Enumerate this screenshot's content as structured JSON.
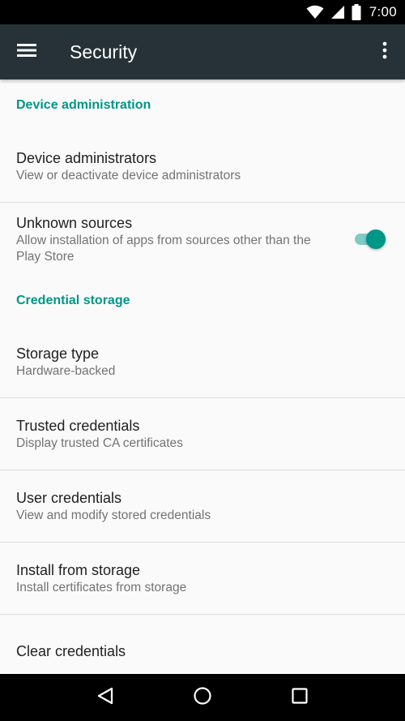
{
  "status_bar": {
    "time": "7:00",
    "icons": [
      "wifi-icon",
      "cellular-signal-icon",
      "battery-icon"
    ]
  },
  "app_bar": {
    "title": "Security",
    "left_icon": "menu-icon",
    "right_icon": "more-vert-icon",
    "background": "#263238"
  },
  "sections": {
    "device_admin": {
      "header": "Device administration",
      "items": [
        {
          "title": "Device administrators",
          "summary": "View or deactivate device administrators"
        }
      ],
      "toggle_item": {
        "title": "Unknown sources",
        "summary": "Allow installation of apps from sources other than the Play Store",
        "enabled": true
      }
    },
    "credential_storage": {
      "header": "Credential storage",
      "items": [
        {
          "title": "Storage type",
          "summary": "Hardware-backed"
        },
        {
          "title": "Trusted credentials",
          "summary": "Display trusted CA certificates"
        },
        {
          "title": "User credentials",
          "summary": "View and modify stored credentials"
        },
        {
          "title": "Install from storage",
          "summary": "Install certificates from storage"
        },
        {
          "title": "Clear credentials"
        }
      ]
    }
  },
  "nav_bar": {
    "icons": [
      "back-icon",
      "home-icon",
      "recents-icon"
    ]
  },
  "colors": {
    "accent": "#009688",
    "accent_light": "#80cbc4",
    "background": "#fafafa",
    "title_text": "#212121",
    "summary_text": "#737373"
  }
}
